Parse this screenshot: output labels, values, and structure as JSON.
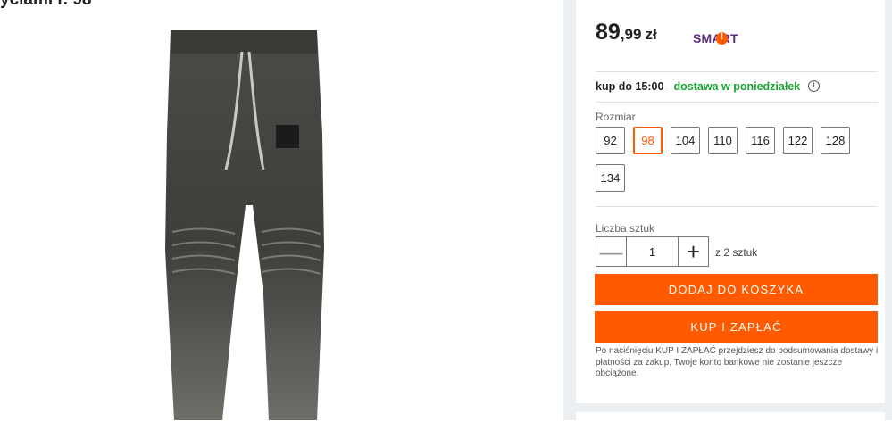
{
  "product": {
    "title_fragment": "yciami r. 98"
  },
  "offer": {
    "price_int": "89",
    "price_dec": ",99",
    "currency": "zł",
    "smart_label": "SMART"
  },
  "delivery": {
    "deadline": "kup do 15:00",
    "separator": " - ",
    "date_text": "dostawa w poniedziałek"
  },
  "size_selector": {
    "label": "Rozmiar",
    "options": [
      "92",
      "98",
      "104",
      "110",
      "116",
      "122",
      "128",
      "134"
    ],
    "selected": "98"
  },
  "quantity": {
    "label": "Liczba sztuk",
    "value": "1",
    "minus": "—",
    "plus": "+",
    "available": "z 2 sztuk"
  },
  "actions": {
    "add_to_cart": "DODAJ DO KOSZYKA",
    "buy_now": "KUP I ZAPŁAĆ"
  },
  "note": "Po naciśnięciu KUP I ZAPŁAĆ przejdziesz do podsumowania dostawy i płatności za zakup. Twoje konto bankowe nie zostanie jeszcze obciążone.",
  "colors": {
    "accent": "#ff5a00",
    "delivery_green": "#1aa531",
    "smart_purple": "#5a2d82",
    "page_gray": "#eceff1"
  }
}
